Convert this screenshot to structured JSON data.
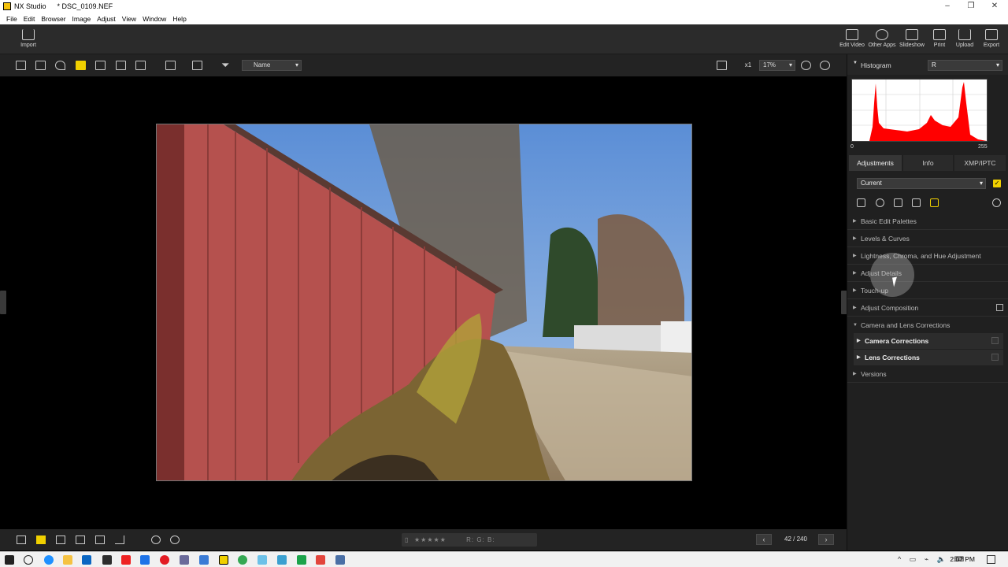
{
  "window": {
    "app_name": "NX Studio",
    "file_title": "* DSC_0109.NEF",
    "controls": [
      "–",
      "❐",
      "✕"
    ]
  },
  "menu": [
    "File",
    "Edit",
    "Browser",
    "Image",
    "Adjust",
    "View",
    "Window",
    "Help"
  ],
  "toolbar": {
    "import_label": "Import",
    "right_buttons": [
      "Edit Video",
      "Other Apps",
      "Slideshow",
      "Print",
      "Upload",
      "Export"
    ]
  },
  "view_toolbar": {
    "sort_label": "Name",
    "zoom_x1": "x1",
    "zoom_value": "17%"
  },
  "bottom": {
    "rating_text": "R:    G:    B:",
    "page_counter": "42 / 240",
    "prev": "‹",
    "next": "›"
  },
  "right_panel": {
    "histogram_label": "Histogram",
    "histogram_channel": "R",
    "histogram_min": "0",
    "histogram_max": "255",
    "tabs": [
      "Adjustments",
      "Info",
      "XMP/IPTC"
    ],
    "preset": "Current",
    "sections": [
      "Basic Edit Palettes",
      "Levels & Curves",
      "Lightness, Chroma, and Hue Adjustment",
      "Adjust Details",
      "Touch-up",
      "Adjust Composition",
      "Camera and Lens Corrections"
    ],
    "subsections": [
      "Camera Corrections",
      "Lens Corrections"
    ],
    "versions": "Versions"
  },
  "taskbar": {
    "clock": "2:07 PM"
  },
  "colors": {
    "accent_yellow": "#f0d000",
    "histogram_red": "#ff0000"
  }
}
